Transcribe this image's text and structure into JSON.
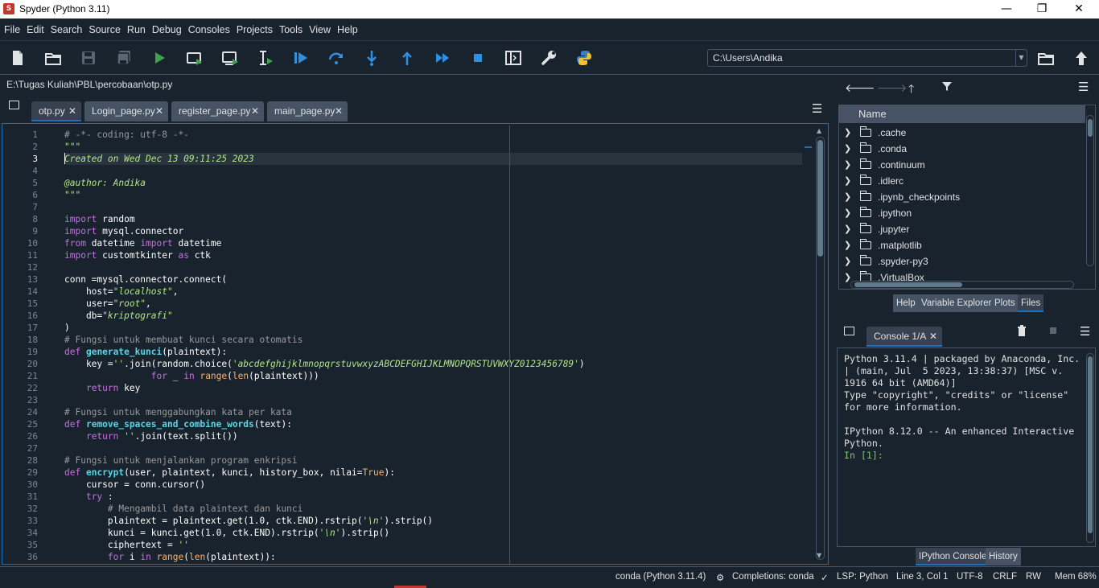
{
  "window": {
    "title": "Spyder (Python 3.11)",
    "minimize": "—",
    "restore": "❐",
    "close": "✕"
  },
  "menu": [
    "File",
    "Edit",
    "Search",
    "Source",
    "Run",
    "Debug",
    "Consoles",
    "Projects",
    "Tools",
    "View",
    "Help"
  ],
  "toolbar": {
    "working_dir": "C:\\Users\\Andika"
  },
  "editor": {
    "file_path": "E:\\Tugas Kuliah\\PBL\\percobaan\\otp.py",
    "tabs": [
      {
        "label": "otp.py",
        "active": true
      },
      {
        "label": "Login_page.py",
        "active": false
      },
      {
        "label": "register_page.py",
        "active": false
      },
      {
        "label": "main_page.py",
        "active": false
      }
    ],
    "current_line": 3,
    "line_numbers": [
      "1",
      "2",
      "3",
      "4",
      "5",
      "6",
      "7",
      "8",
      "9",
      "10",
      "11",
      "12",
      "13",
      "14",
      "15",
      "16",
      "17",
      "18",
      "19",
      "20",
      "21",
      "22",
      "23",
      "24",
      "25",
      "26",
      "27",
      "28",
      "29",
      "30",
      "31",
      "32",
      "33",
      "34",
      "35",
      "36"
    ],
    "lines": [
      [
        [
          "cm",
          "# -*- coding: utf-8 -*-"
        ]
      ],
      [
        [
          "ds",
          "\"\"\""
        ]
      ],
      [
        [
          "ds",
          "Created on Wed Dec 13 09:11:25 2023"
        ]
      ],
      [
        [
          "ds",
          ""
        ]
      ],
      [
        [
          "ds",
          "@author: Andika"
        ]
      ],
      [
        [
          "ds",
          "\"\"\""
        ]
      ],
      [
        [
          "",
          ""
        ]
      ],
      [
        [
          "kw",
          "import"
        ],
        [
          "",
          " random"
        ]
      ],
      [
        [
          "kw",
          "import"
        ],
        [
          "",
          " mysql.connector"
        ]
      ],
      [
        [
          "kw",
          "from"
        ],
        [
          "",
          " datetime "
        ],
        [
          "kw",
          "import"
        ],
        [
          "",
          " datetime"
        ]
      ],
      [
        [
          "kw",
          "import"
        ],
        [
          "",
          " customtkinter "
        ],
        [
          "kw",
          "as"
        ],
        [
          "",
          " ctk"
        ]
      ],
      [
        [
          "",
          ""
        ]
      ],
      [
        [
          "",
          "conn =mysql.connector.connect("
        ]
      ],
      [
        [
          "",
          "    host="
        ],
        [
          "st",
          "\"localhost\""
        ],
        [
          "",
          ","
        ]
      ],
      [
        [
          "",
          "    user="
        ],
        [
          "st",
          "\"root\""
        ],
        [
          "",
          ","
        ]
      ],
      [
        [
          "",
          "    db="
        ],
        [
          "st",
          "\"kriptografi\""
        ]
      ],
      [
        [
          "",
          ")"
        ]
      ],
      [
        [
          "cm",
          "# Fungsi untuk membuat kunci secara otomatis"
        ]
      ],
      [
        [
          "kw",
          "def"
        ],
        [
          "",
          " "
        ],
        [
          "fn",
          "generate_kunci"
        ],
        [
          "",
          "(plaintext):"
        ]
      ],
      [
        [
          "",
          "    key ="
        ],
        [
          "st",
          "''"
        ],
        [
          "",
          ".join(random.choice("
        ],
        [
          "st",
          "'abcdefghijklmnopqrstuvwxyzABCDEFGHIJKLMNOPQRSTUVWXYZ0123456789'"
        ],
        [
          "",
          ")"
        ]
      ],
      [
        [
          "",
          "                "
        ],
        [
          "kw",
          "for"
        ],
        [
          "",
          " _ "
        ],
        [
          "kw",
          "in"
        ],
        [
          "",
          " "
        ],
        [
          "bi",
          "range"
        ],
        [
          "",
          "("
        ],
        [
          "bi",
          "len"
        ],
        [
          "",
          "(plaintext)))"
        ]
      ],
      [
        [
          "",
          "    "
        ],
        [
          "kw",
          "return"
        ],
        [
          "",
          " key"
        ]
      ],
      [
        [
          "",
          ""
        ]
      ],
      [
        [
          "cm",
          "# Fungsi untuk menggabungkan kata per kata"
        ]
      ],
      [
        [
          "kw",
          "def"
        ],
        [
          "",
          " "
        ],
        [
          "fn",
          "remove_spaces_and_combine_words"
        ],
        [
          "",
          "(text):"
        ]
      ],
      [
        [
          "",
          "    "
        ],
        [
          "kw",
          "return"
        ],
        [
          "",
          " "
        ],
        [
          "st",
          "''"
        ],
        [
          "",
          ".join(text.split())"
        ]
      ],
      [
        [
          "",
          ""
        ]
      ],
      [
        [
          "cm",
          "# Fungsi untuk menjalankan program enkripsi"
        ]
      ],
      [
        [
          "kw",
          "def"
        ],
        [
          "",
          " "
        ],
        [
          "fn",
          "encrypt"
        ],
        [
          "",
          "(user, plaintext, kunci, history_box, nilai="
        ],
        [
          "bi",
          "True"
        ],
        [
          "",
          "):"
        ]
      ],
      [
        [
          "",
          "    cursor = conn.cursor()"
        ]
      ],
      [
        [
          "",
          "    "
        ],
        [
          "kw",
          "try"
        ],
        [
          "",
          " :"
        ]
      ],
      [
        [
          "",
          "        "
        ],
        [
          "cm",
          "# Mengambil data plaintext dan kunci"
        ]
      ],
      [
        [
          "",
          "        plaintext = plaintext.get(1.0, ctk.END).rstrip("
        ],
        [
          "st",
          "'\\n'"
        ],
        [
          "",
          ").strip()"
        ]
      ],
      [
        [
          "",
          "        kunci = kunci.get(1.0, ctk.END).rstrip("
        ],
        [
          "st",
          "'\\n'"
        ],
        [
          "",
          ").strip()"
        ]
      ],
      [
        [
          "",
          "        ciphertext = "
        ],
        [
          "st",
          "''"
        ]
      ],
      [
        [
          "",
          "        "
        ],
        [
          "kw",
          "for"
        ],
        [
          "",
          " i "
        ],
        [
          "kw",
          "in"
        ],
        [
          "",
          " "
        ],
        [
          "bi",
          "range"
        ],
        [
          "",
          "("
        ],
        [
          "bi",
          "len"
        ],
        [
          "",
          "(plaintext)):"
        ]
      ]
    ]
  },
  "files_pane": {
    "header": "Name",
    "items": [
      ".cache",
      ".conda",
      ".continuum",
      ".idlerc",
      ".ipynb_checkpoints",
      ".ipython",
      ".jupyter",
      ".matplotlib",
      ".spyder-py3",
      ".VirtualBox"
    ],
    "tabs": [
      "Help",
      "Variable Explorer",
      "Plots",
      "Files"
    ],
    "active_tab": "Files"
  },
  "console": {
    "tab_label": "Console 1/A",
    "text": "Python 3.11.4 | packaged by Anaconda, Inc.\n| (main, Jul  5 2023, 13:38:37) [MSC v.\n1916 64 bit (AMD64)]\nType \"copyright\", \"credits\" or \"license\"\nfor more information.\n\nIPython 8.12.0 -- An enhanced Interactive\nPython.\n",
    "prompt": "In [1]:",
    "tabs": [
      "IPython Console",
      "History"
    ],
    "active_tab": "IPython Console"
  },
  "status": {
    "env": "conda (Python 3.11.4)",
    "completions": "Completions: conda",
    "lsp": "LSP: Python",
    "position": "Line 3, Col 1",
    "encoding": "UTF-8",
    "eol": "CRLF",
    "rw": "RW",
    "mem": "Mem 68%"
  },
  "colors": {
    "background": "#19232d",
    "accent": "#1a72bb",
    "keyword": "#c670e0",
    "string": "#b0e686",
    "function": "#57d6e4",
    "builtin": "#fab16c",
    "comment": "#999999"
  }
}
